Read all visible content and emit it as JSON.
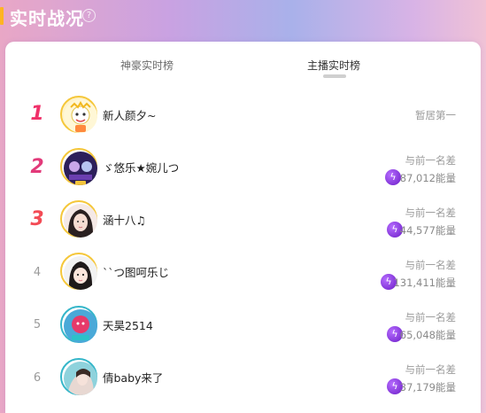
{
  "header": {
    "title": "实时战况",
    "help": "?"
  },
  "tabs": [
    {
      "label": "神豪实时榜",
      "active": false
    },
    {
      "label": "主播实时榜",
      "active": true
    }
  ],
  "ranking": [
    {
      "rank": "1",
      "name": "新人颜夕~",
      "status": "暂居第一"
    },
    {
      "rank": "2",
      "name": "ゞ悠乐★婉儿つ",
      "diff_label": "与前一名差",
      "diff_value": "87,012能量"
    },
    {
      "rank": "3",
      "name": "涵十八♫",
      "diff_label": "与前一名差",
      "diff_value": "44,577能量"
    },
    {
      "rank": "4",
      "name": "``つ图呵乐じ",
      "diff_label": "与前一名差",
      "diff_value": "131,411能量"
    },
    {
      "rank": "5",
      "name": "天昊2514",
      "diff_label": "与前一名差",
      "diff_value": "65,048能量"
    },
    {
      "rank": "6",
      "name": "倩baby来了",
      "diff_label": "与前一名差",
      "diff_value": "37,179能量"
    }
  ],
  "colors": {
    "accent": "#ffb422",
    "medal": "#f0316a",
    "energy": "#8a2be2"
  }
}
